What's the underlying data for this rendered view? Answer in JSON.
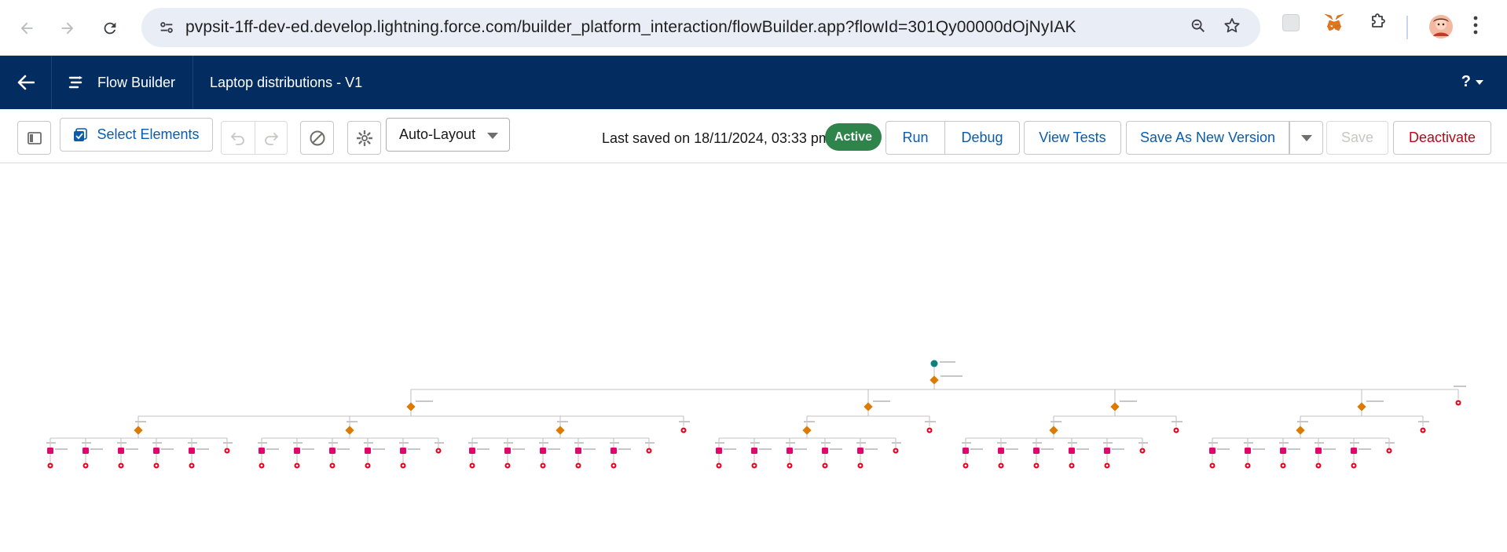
{
  "browser": {
    "url": "pvpsit-1ff-dev-ed.develop.lightning.force.com/builder_platform_interaction/flowBuilder.app?flowId=301Qy00000dOjNyIAK"
  },
  "header": {
    "app_name": "Flow Builder",
    "flow_name": "Laptop distributions - V1",
    "help_label": "?"
  },
  "toolbar": {
    "select_elements_label": "Select Elements",
    "layout_label": "Auto-Layout",
    "last_saved": "Last saved on 18/11/2024, 03:33 pm",
    "status_badge": "Active",
    "run_label": "Run",
    "debug_label": "Debug",
    "view_tests_label": "View Tests",
    "save_as_new_label": "Save As New Version",
    "save_label": "Save",
    "deactivate_label": "Deactivate"
  },
  "colors": {
    "header_bg": "#032d60",
    "brand_blue": "#0b5cab",
    "active_green": "#2e844a",
    "deactivate_red": "#ba0517",
    "decision_orange": "#dd7a01",
    "action_pink": "#e3066a",
    "end_red": "#ea001e",
    "start_teal": "#0b827c"
  },
  "icons": {
    "back": "arrow-left-icon",
    "forward": "arrow-right-icon",
    "reload": "reload-icon",
    "site_info": "tune-icon",
    "zoom": "zoom-icon",
    "bookmark": "star-icon",
    "extensions": "puzzle-icon",
    "menu": "kebab-icon"
  }
}
